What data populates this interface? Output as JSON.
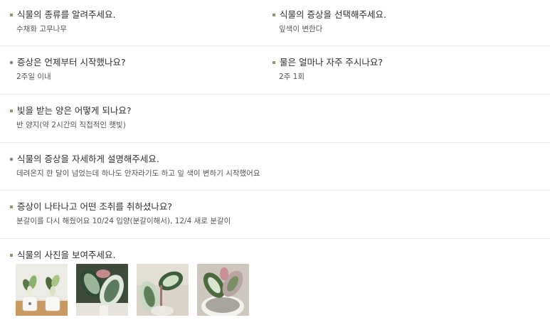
{
  "sections": [
    {
      "fields": [
        {
          "question": "식물의 종류를 알려주세요.",
          "answer": "수채화 고무나무"
        },
        {
          "question": "식물의 증상을 선택해주세요.",
          "answer": "잎색이 변한다"
        }
      ]
    },
    {
      "fields": [
        {
          "question": "증상은 언제부터 시작했나요?",
          "answer": "2주일 이내"
        },
        {
          "question": "물은 얼마나 자주 주시나요?",
          "answer": "2주 1회"
        }
      ]
    },
    {
      "fields": [
        {
          "question": "빛을 받는 양은 어떻게 되나요?",
          "answer": "반 양지(약 2시간의 직접적인 햇빛)"
        }
      ]
    },
    {
      "fields": [
        {
          "question": "식물의 증상을 자세하게 설명해주세요.",
          "answer": "데려온지 한 달이 넘었는데 하나도 안자라기도 하고 잎 색이 변하기 시작했어요"
        }
      ]
    },
    {
      "fields": [
        {
          "question": "증상이 나타나고 어떤 조취를 취하셨나요?",
          "answer": "분갈이를 다시 해줬어요 10/24 입양(분갈이해서), 12/4 새로 분갈이"
        }
      ]
    },
    {
      "fields": [
        {
          "question": "식물의 사진을 보여주세요."
        }
      ]
    }
  ],
  "photos": [
    {
      "icon": "plant-photo-icon",
      "subject": "two variegated rubber plants in white pots"
    },
    {
      "icon": "plant-photo-icon",
      "subject": "variegated rubber plant leaves closeup"
    },
    {
      "icon": "plant-photo-icon",
      "subject": "variegated rubber plant stem with pink tinge"
    },
    {
      "icon": "plant-photo-icon",
      "subject": "rubber plant in white pot top view"
    }
  ],
  "colors": {
    "bullet": "#8c9a6f",
    "divider": "#e6e6e6",
    "question_text": "#2f2f2f",
    "answer_text": "#555555"
  }
}
